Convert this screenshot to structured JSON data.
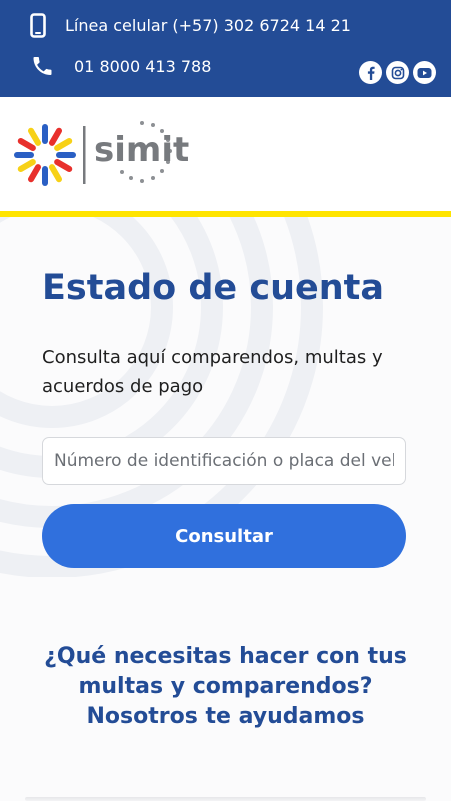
{
  "topbar": {
    "cell_line": "Línea celular (+57) 302 6724 14 21",
    "toll_free": "01 8000 413 788",
    "social": [
      "facebook-icon",
      "instagram-icon",
      "youtube-icon"
    ]
  },
  "header": {
    "logo_text": "simit"
  },
  "main": {
    "title": "Estado de cuenta",
    "subtitle": "Consulta aquí comparendos, multas y acuerdos de pago",
    "search_placeholder": "Número de identificación o placa del vehículo",
    "search_value": "",
    "button_label": "Consultar"
  },
  "help_section": {
    "heading": "¿Qué necesitas hacer con tus multas y comparendos? Nosotros te ayudamos"
  },
  "colors": {
    "brand_blue": "#234c96",
    "button_blue": "#3070dd",
    "accent_yellow": "#ffe400",
    "logo_red": "#e8302c",
    "logo_blue": "#2a5fc4",
    "logo_yellow": "#f7d117"
  }
}
